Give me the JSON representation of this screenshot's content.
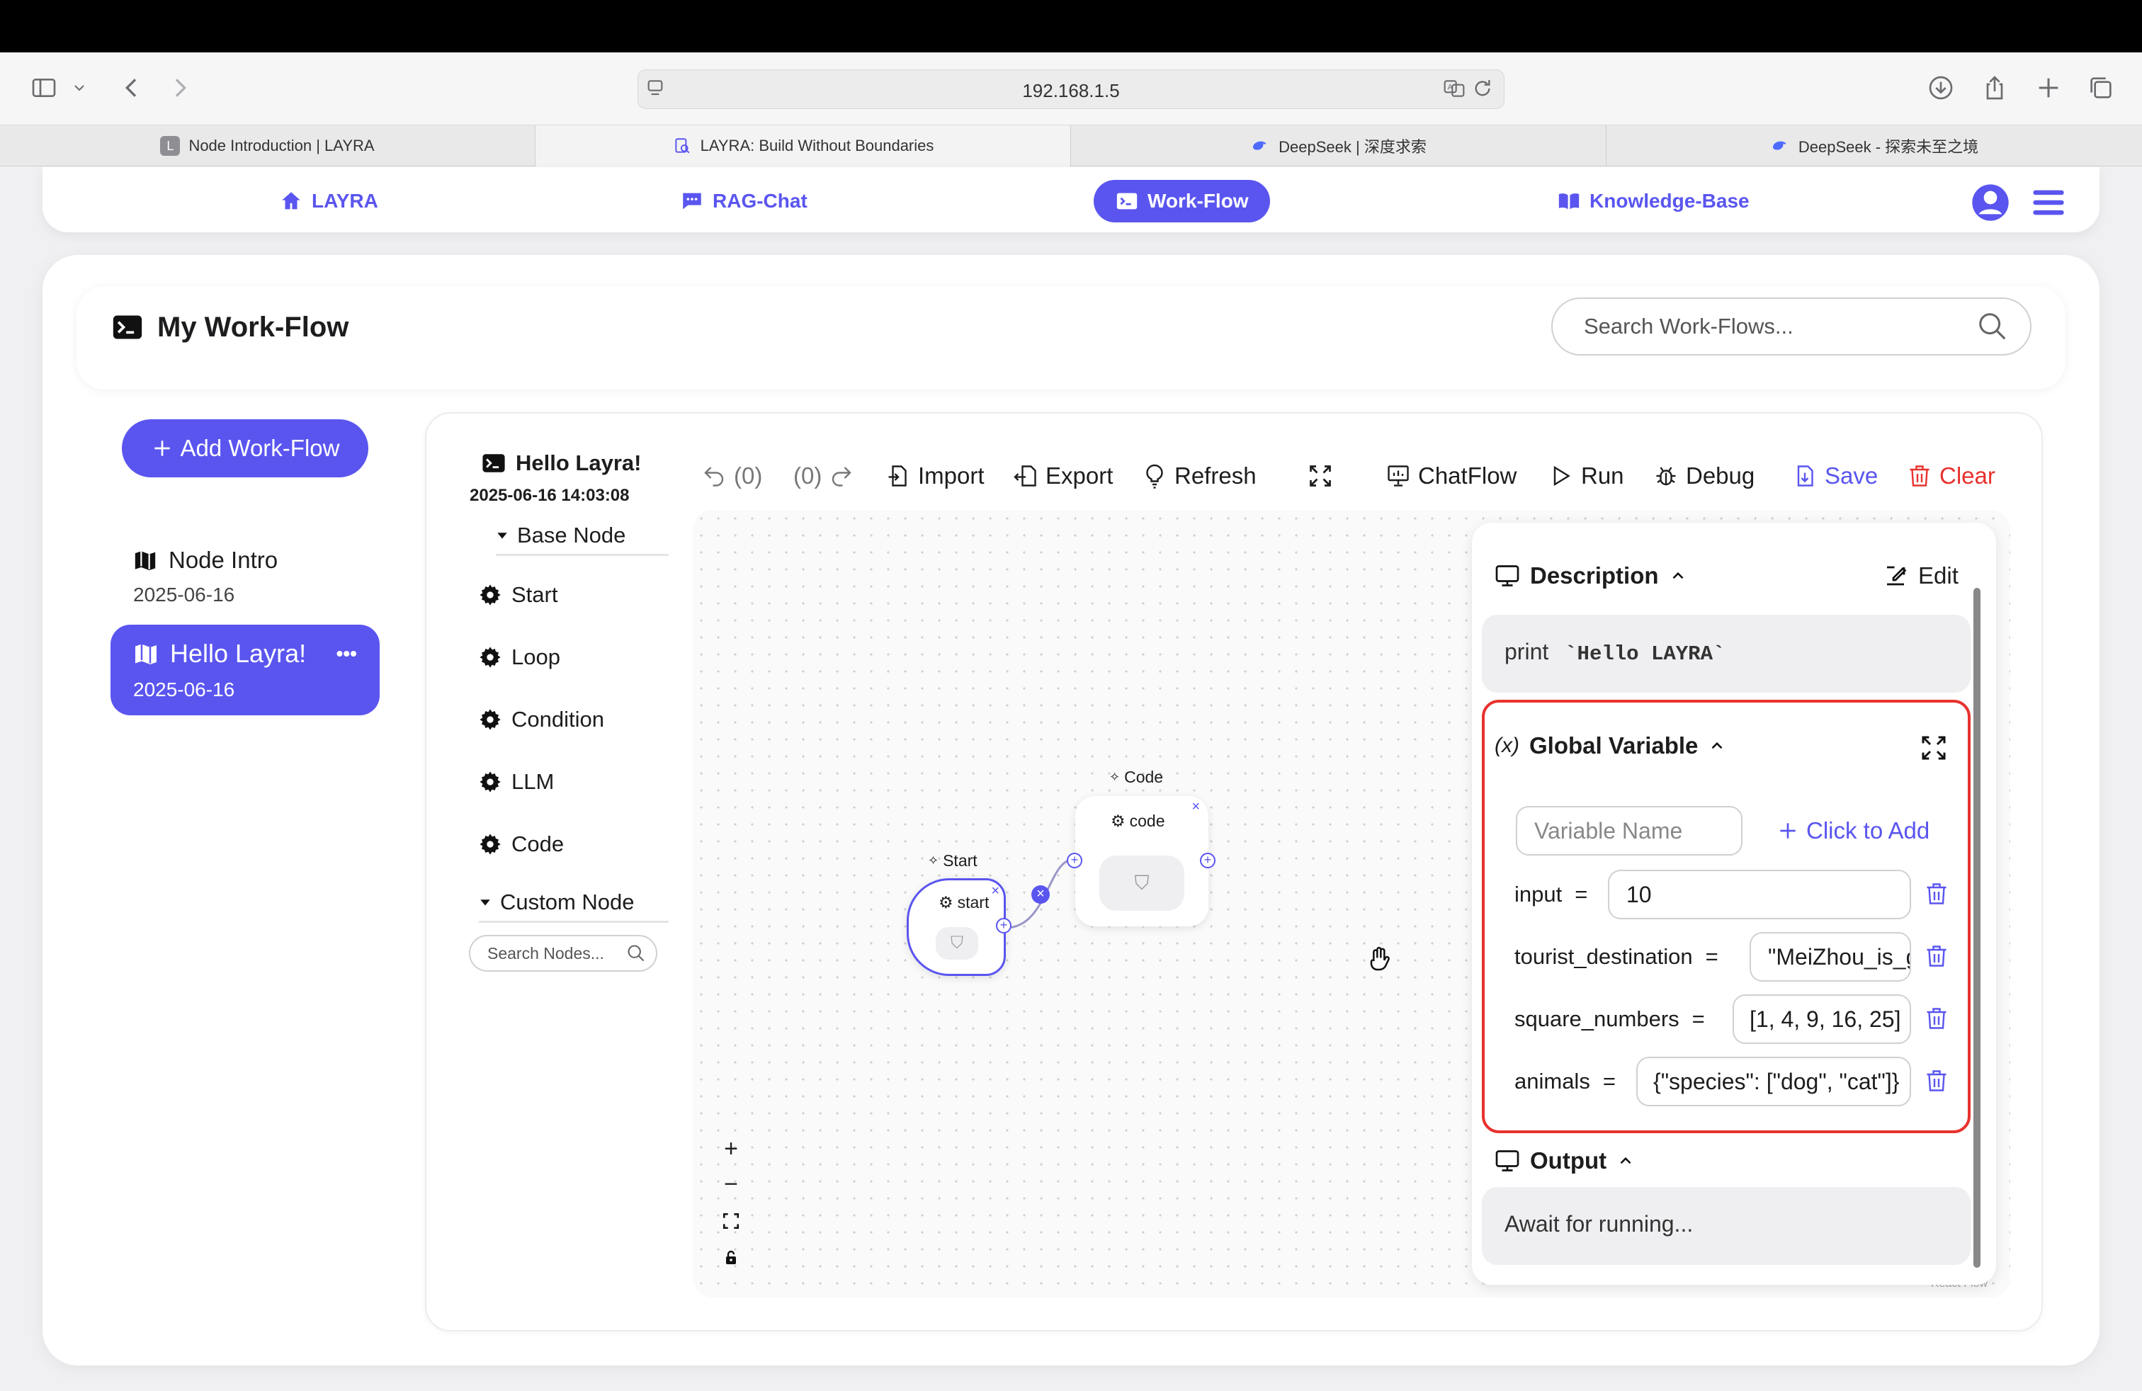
{
  "browser": {
    "url": "192.168.1.5",
    "tabs": [
      {
        "title": "Node Introduction | LAYRA",
        "favicon": "L"
      },
      {
        "title": "LAYRA: Build Without Boundaries",
        "favicon": "doc-search-icon"
      },
      {
        "title": "DeepSeek | 深度求索",
        "favicon": "whale-icon"
      },
      {
        "title": "DeepSeek - 探索未至之境",
        "favicon": "whale-icon"
      }
    ]
  },
  "nav": {
    "layra": "LAYRA",
    "rag_chat": "RAG-Chat",
    "work_flow": "Work-Flow",
    "knowledge_base": "Knowledge-Base"
  },
  "page": {
    "title": "My Work-Flow",
    "search_placeholder": "Search Work-Flows...",
    "add_workflow": "Add Work-Flow"
  },
  "workflows": [
    {
      "name": "Node Intro",
      "date": "2025-06-16",
      "selected": false
    },
    {
      "name": "Hello Layra!",
      "date": "2025-06-16",
      "selected": true,
      "more": "•••"
    }
  ],
  "editor": {
    "name": "Hello Layra!",
    "datetime": "2025-06-16 14:03:08",
    "base_node_header": "Base Node",
    "base_nodes": [
      "Start",
      "Loop",
      "Condition",
      "LLM",
      "Code"
    ],
    "custom_node_header": "Custom Node",
    "search_nodes_placeholder": "Search Nodes...",
    "toolbar": {
      "undo": "(0)",
      "redo": "(0)",
      "import": "Import",
      "export": "Export",
      "refresh": "Refresh",
      "chatflow": "ChatFlow",
      "run": "Run",
      "debug": "Debug",
      "save": "Save",
      "clear": "Clear"
    }
  },
  "canvas": {
    "nodes": [
      {
        "type_label": "Start",
        "name": "start"
      },
      {
        "type_label": "Code",
        "name": "code"
      }
    ],
    "zoom_in": "+",
    "zoom_out": "−",
    "watermark": "React Flow"
  },
  "panel": {
    "description_title": "Description",
    "edit": "Edit",
    "description_text": "print",
    "description_code": "`Hello LAYRA`",
    "global_title": "Global Variable",
    "var_name_placeholder": "Variable Name",
    "click_to_add": "Click to Add",
    "variables": [
      {
        "name": "input",
        "value": "10"
      },
      {
        "name": "tourist_destination",
        "value": "\"MeiZhou_is_good\""
      },
      {
        "name": "square_numbers",
        "value": "[1, 4, 9, 16, 25]"
      },
      {
        "name": "animals",
        "value": "{\"species\": [\"dog\", \"cat\"]}"
      }
    ],
    "output_title": "Output",
    "output_text": "Await for running..."
  },
  "colors": {
    "accent": "#5a55ef",
    "danger": "#e8322e"
  }
}
